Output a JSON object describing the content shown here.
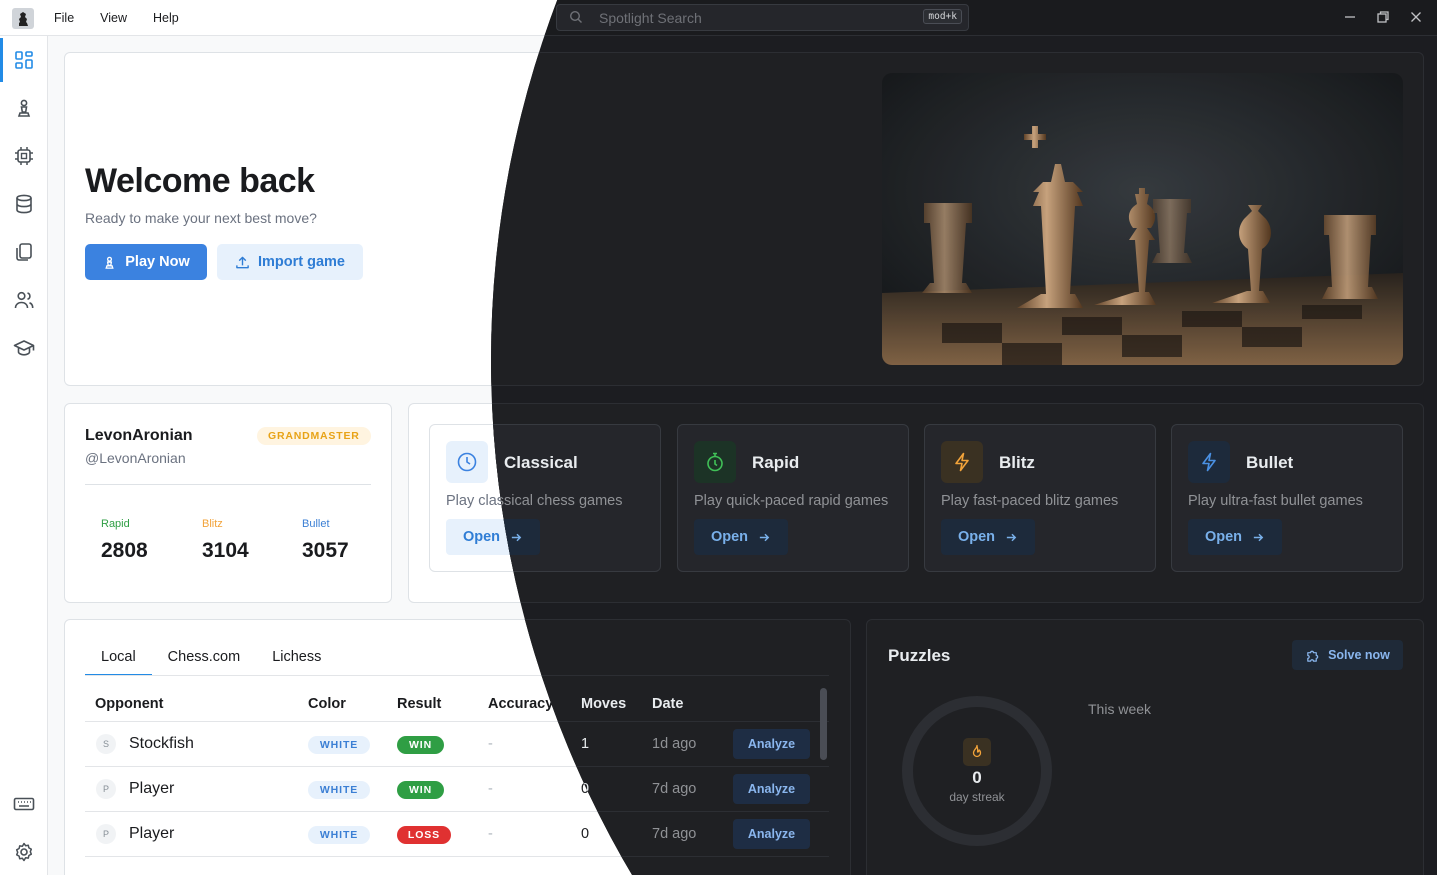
{
  "menu": {
    "items": [
      "File",
      "View",
      "Help"
    ]
  },
  "search": {
    "placeholder": "Spotlight Search",
    "shortcut": "mod+k"
  },
  "sidebar": {
    "items": [
      "dashboard",
      "play",
      "engines",
      "databases",
      "files",
      "players",
      "learn"
    ],
    "bottom_items": [
      "keyboard-shortcuts",
      "settings"
    ]
  },
  "hero": {
    "title": "Welcome back",
    "subtitle": "Ready to make your next best move?",
    "play_now": "Play Now",
    "import_game": "Import game"
  },
  "profile": {
    "name": "LevonAronian",
    "handle": "@LevonAronian",
    "badge": "GRANDMASTER",
    "ratings": [
      {
        "label": "Rapid",
        "value": "2808",
        "color": "#2f9e44"
      },
      {
        "label": "Blitz",
        "value": "3104",
        "color": "#f2a33a"
      },
      {
        "label": "Bullet",
        "value": "3057",
        "color": "#3b7fd4"
      }
    ]
  },
  "modes": [
    {
      "title": "Classical",
      "desc": "Play classical chess games",
      "button": "Open",
      "icon": "clock-icon",
      "accent": "#3b82e0"
    },
    {
      "title": "Rapid",
      "desc": "Play quick-paced rapid games",
      "button": "Open",
      "icon": "stopwatch-icon",
      "accent": "#2f9e44"
    },
    {
      "title": "Blitz",
      "desc": "Play fast-paced blitz games",
      "button": "Open",
      "icon": "bolt-icon",
      "accent": "#f2a33a"
    },
    {
      "title": "Bullet",
      "desc": "Play ultra-fast bullet games",
      "button": "Open",
      "icon": "bolt-icon",
      "accent": "#3b82e0"
    }
  ],
  "games": {
    "tabs": [
      "Local",
      "Chess.com",
      "Lichess"
    ],
    "active_tab": "Local",
    "columns": [
      "Opponent",
      "Color",
      "Result",
      "Accuracy",
      "Moves",
      "Date"
    ],
    "rows": [
      {
        "avatar": "S",
        "opponent": "Stockfish",
        "color": "WHITE",
        "result": "WIN",
        "accuracy": "-",
        "moves": "1",
        "date": "1d ago",
        "action": "Analyze"
      },
      {
        "avatar": "P",
        "opponent": "Player",
        "color": "WHITE",
        "result": "WIN",
        "accuracy": "-",
        "moves": "0",
        "date": "7d ago",
        "action": "Analyze"
      },
      {
        "avatar": "P",
        "opponent": "Player",
        "color": "WHITE",
        "result": "LOSS",
        "accuracy": "-",
        "moves": "0",
        "date": "7d ago",
        "action": "Analyze"
      }
    ]
  },
  "puzzles": {
    "title": "Puzzles",
    "solve_now": "Solve now",
    "streak_value": "0",
    "streak_label": "day streak",
    "period": "This week"
  }
}
